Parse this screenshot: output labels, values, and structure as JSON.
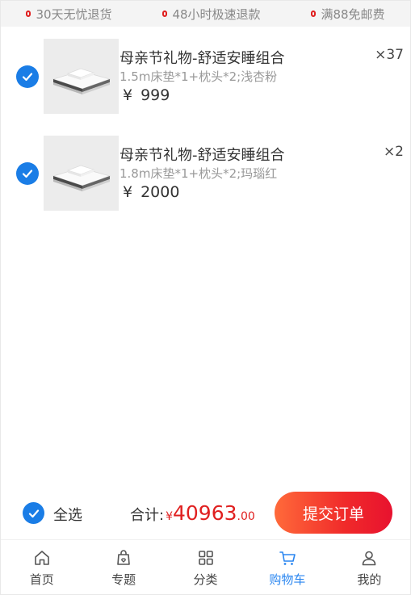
{
  "promises": [
    {
      "text": "30天无忧退货"
    },
    {
      "text": "48小时极速退款"
    },
    {
      "text": "满88免邮费"
    }
  ],
  "cart": {
    "items": [
      {
        "title": "母亲节礼物-舒适安睡组合",
        "spec": "1.5m床垫*1+枕头*2;浅杏粉",
        "currency": "¥",
        "price": "999",
        "qty": "×37",
        "checked": true
      },
      {
        "title": "母亲节礼物-舒适安睡组合",
        "spec": "1.8m床垫*1+枕头*2;玛瑙红",
        "currency": "¥",
        "price": "2000",
        "qty": "×2",
        "checked": true
      }
    ]
  },
  "summary": {
    "select_all_label": "全选",
    "total_label": "合计:",
    "currency": "¥",
    "total_int": "40963",
    "total_dec": ".00",
    "submit_label": "提交订单"
  },
  "tabbar": {
    "tabs": [
      {
        "label": "首页",
        "icon": "home-icon",
        "active": false
      },
      {
        "label": "专题",
        "icon": "topic-bag-icon",
        "active": false
      },
      {
        "label": "分类",
        "icon": "grid-icon",
        "active": false
      },
      {
        "label": "购物车",
        "icon": "cart-icon",
        "active": true
      },
      {
        "label": "我的",
        "icon": "user-icon",
        "active": false
      }
    ]
  },
  "colors": {
    "accent_blue": "#1a7de6",
    "price_red": "#e02020",
    "tab_active": "#2a86f0"
  }
}
